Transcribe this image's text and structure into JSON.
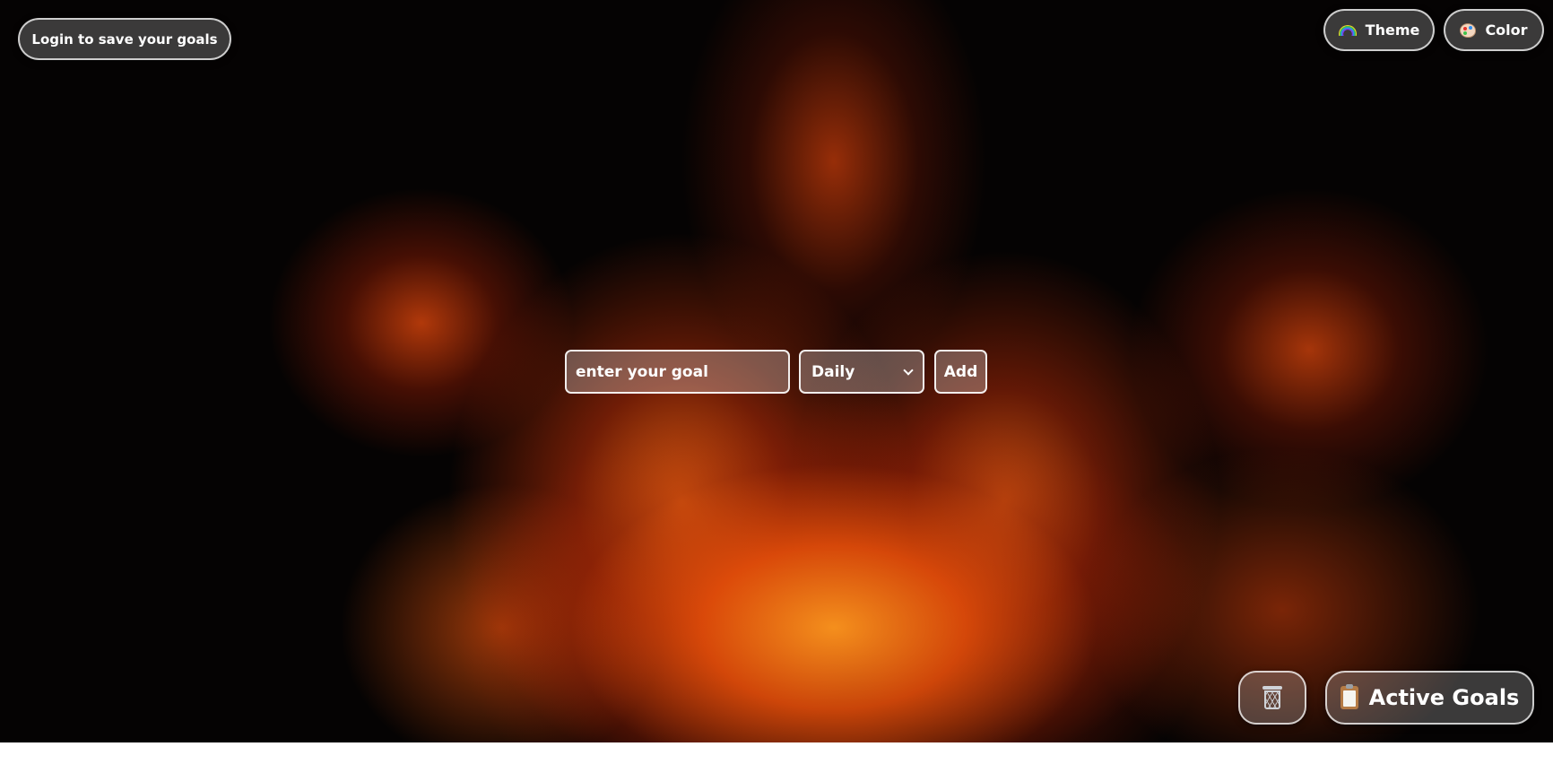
{
  "header": {
    "login_label": "Login to save your goals",
    "theme_label": "Theme",
    "theme_icon": "rainbow-icon",
    "color_label": "Color",
    "color_icon": "palette-icon"
  },
  "goal_form": {
    "input_placeholder": "enter your goal",
    "input_value": "",
    "frequency_selected": "Daily",
    "add_label": "Add"
  },
  "footer_actions": {
    "trash_icon": "trash-icon",
    "active_goals_label": "Active Goals",
    "active_goals_icon": "clipboard-icon"
  },
  "colors": {
    "background": "#050303",
    "flame_orange": "#f26a1b",
    "button_border": "#ffffff",
    "text": "#ffffff"
  }
}
